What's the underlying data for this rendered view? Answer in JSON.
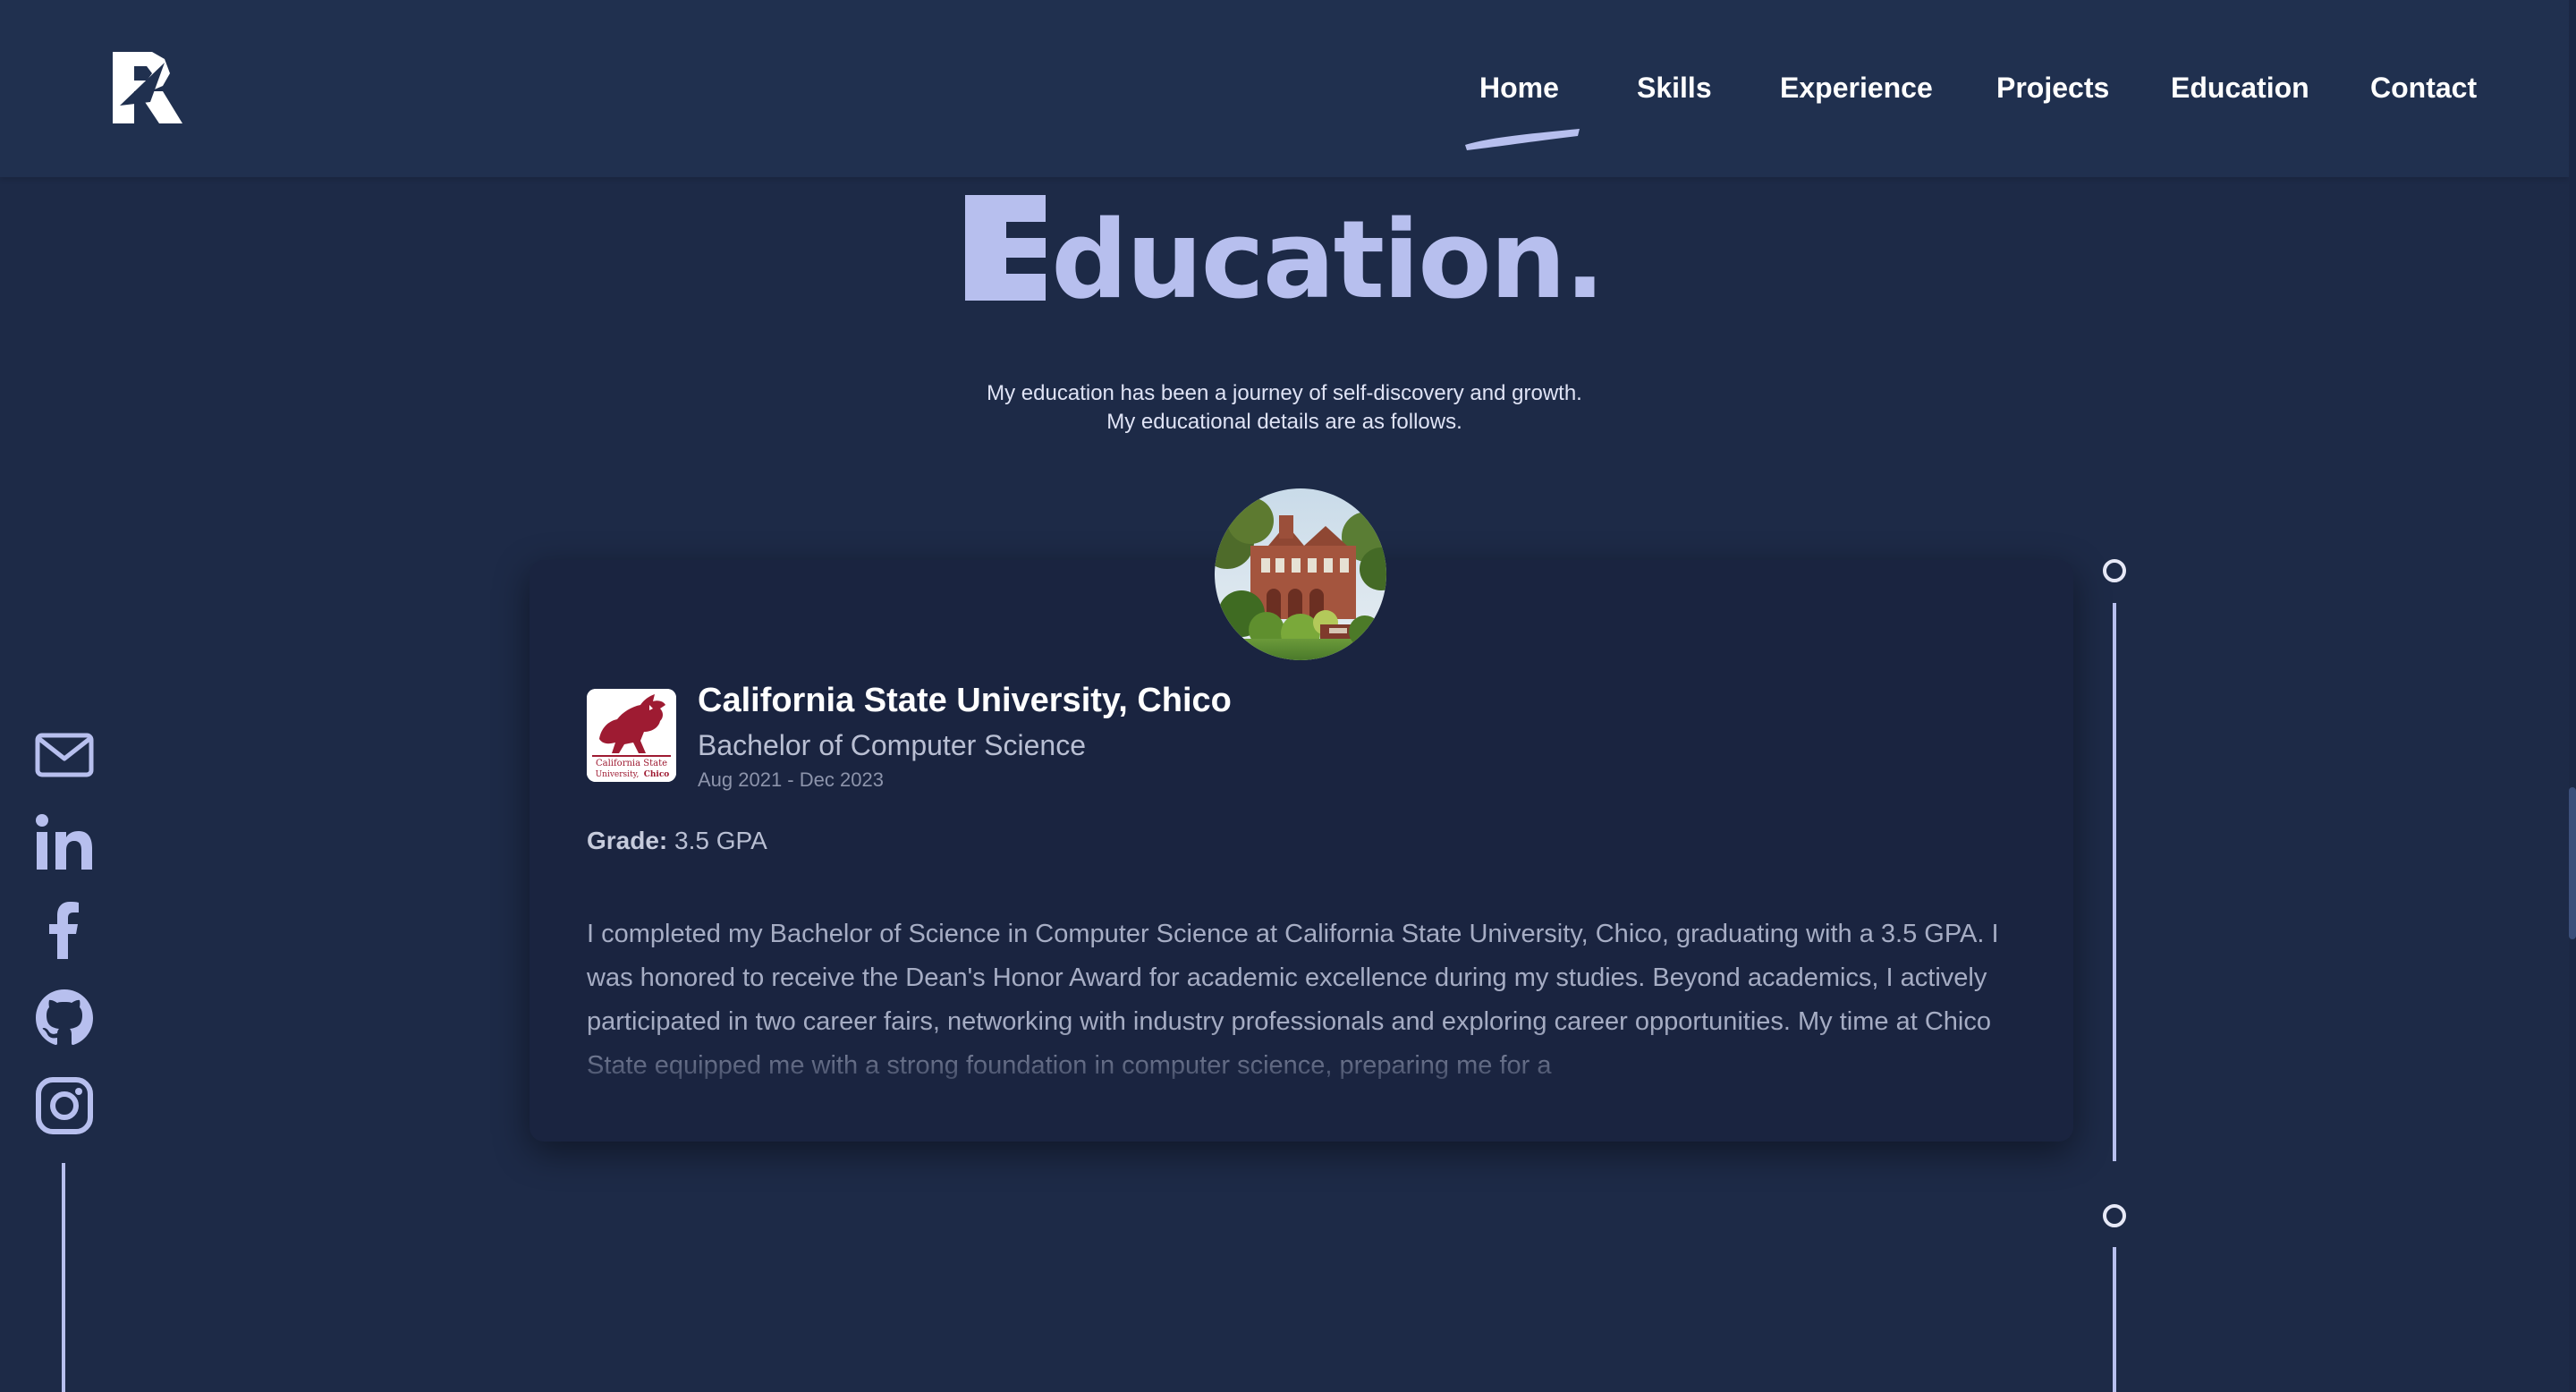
{
  "nav": {
    "items": [
      {
        "label": "Home",
        "active": true
      },
      {
        "label": "Skills"
      },
      {
        "label": "Experience"
      },
      {
        "label": "Projects"
      },
      {
        "label": "Education"
      },
      {
        "label": "Contact"
      }
    ]
  },
  "section": {
    "title_first_letter": "E",
    "title_rest": "ducation.",
    "subtitle_line1": "My education has been a journey of self-discovery and growth.",
    "subtitle_line2": "My educational details are as follows."
  },
  "social": {
    "icons": [
      "mail-icon",
      "linkedin-icon",
      "facebook-icon",
      "github-icon",
      "instagram-icon"
    ]
  },
  "education": [
    {
      "school": "California State University, Chico",
      "logo_text_line1": "California State",
      "logo_text_line2": "University,",
      "logo_text_line3": "Chico",
      "degree": "Bachelor of Computer Science",
      "dates": "Aug 2021 - Dec 2023",
      "grade_label": "Grade:",
      "grade_value": "3.5 GPA",
      "description": "I completed my Bachelor of Science in Computer Science at California State University, Chico, graduating with a 3.5 GPA. I was honored to receive the Dean's Honor Award for academic excellence during my studies. Beyond academics, I actively participated in two career fairs, networking with industry professionals and exploring career opportunities. My time at Chico State equipped me with a strong foundation in computer science, preparing me for a"
    }
  ],
  "colors": {
    "background": "#1d2a47",
    "header": "#20304f",
    "accent": "#b7bfee",
    "card": "#1a2440",
    "logo_red": "#9e1b32"
  }
}
